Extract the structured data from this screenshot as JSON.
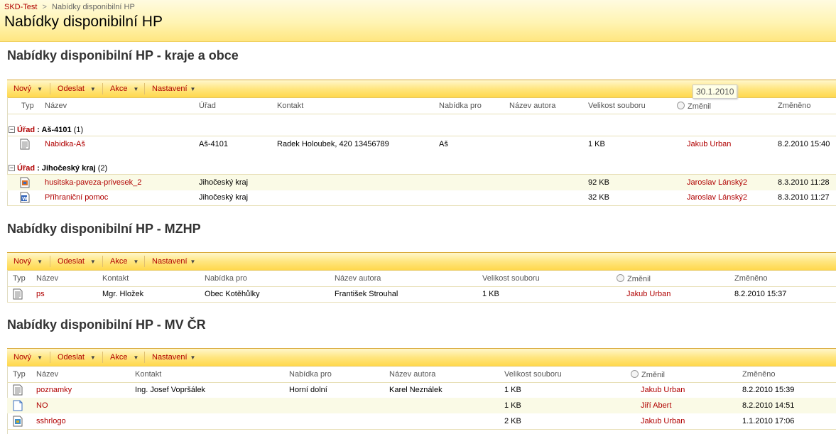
{
  "breadcrumb": {
    "site": "SKD-Test",
    "separator": ">",
    "current": "Nabídky disponibilní HP"
  },
  "page_title": "Nabídky disponibilní HP",
  "tooltip": "30.1.2010",
  "toolbar": {
    "new": "Nový",
    "send": "Odeslat",
    "actions": "Akce",
    "settings": "Nastavení"
  },
  "sections": [
    {
      "title": "Nabídky disponibilní HP - kraje a obce",
      "headers": [
        "Typ",
        "Název",
        "Úřad",
        "Kontakt",
        "Nabídka pro",
        "Název autora",
        "Velikost souboru",
        "Změnil",
        "Změněno"
      ],
      "groups": [
        {
          "label": "Úřad",
          "value": "Aš-4101",
          "count": "(1)",
          "rows": [
            {
              "icon": "text-document",
              "name": "Nabidka-Aš",
              "office": "Aš-4101",
              "contact": "Radek Holoubek, 420 13456789",
              "offer_for": "Aš",
              "author": "",
              "size": "1 KB",
              "changed_by": "Jakub Urban",
              "changed": "8.2.2010 15:40"
            }
          ]
        },
        {
          "label": "Úřad",
          "value": "Jihočeský kraj",
          "count": "(2)",
          "rows": [
            {
              "icon": "image-document",
              "name": "husitska-paveza-privesek_2",
              "office": "Jihočeský kraj",
              "contact": "",
              "offer_for": "",
              "author": "",
              "size": "92 KB",
              "changed_by": "Jaroslav Lánský2",
              "changed": "8.3.2010 11:28"
            },
            {
              "icon": "word-document",
              "name": "Příhraniční pomoc",
              "office": "Jihočeský kraj",
              "contact": "",
              "offer_for": "",
              "author": "",
              "size": "32 KB",
              "changed_by": "Jaroslav Lánský2",
              "changed": "8.3.2010 11:27"
            }
          ]
        }
      ]
    },
    {
      "title": "Nabídky disponibilní HP - MZHP",
      "headers": [
        "Typ",
        "Název",
        "Kontakt",
        "Nabídka pro",
        "Název autora",
        "Velikost souboru",
        "Změnil",
        "Změněno"
      ],
      "rows": [
        {
          "icon": "text-document",
          "name": "ps",
          "contact": "Mgr. Hložek",
          "offer_for": "Obec Kotěhůlky",
          "author": "František Strouhal",
          "size": "1 KB",
          "changed_by": "Jakub Urban",
          "changed": "8.2.2010 15:37"
        }
      ]
    },
    {
      "title": "Nabídky disponibilní HP - MV ČR",
      "headers": [
        "Typ",
        "Název",
        "Kontakt",
        "Nabídka pro",
        "Název autora",
        "Velikost souboru",
        "Změnil",
        "Změněno"
      ],
      "rows": [
        {
          "icon": "text-document",
          "name": "poznamky",
          "contact": "Ing. Josef Vopršálek",
          "offer_for": "Horní dolní",
          "author": "Karel Neználek",
          "size": "1 KB",
          "changed_by": "Jakub Urban",
          "changed": "8.2.2010 15:39"
        },
        {
          "icon": "blank-document",
          "name": "NO",
          "contact": "",
          "offer_for": "",
          "author": "",
          "size": "1 KB",
          "changed_by": "Jiří Abert",
          "changed": "8.2.2010 14:51"
        },
        {
          "icon": "image-document",
          "name": "sshrlogo",
          "contact": "",
          "offer_for": "",
          "author": "",
          "size": "2 KB",
          "changed_by": "Jakub Urban",
          "changed": "1.1.2010 17:06"
        }
      ]
    }
  ]
}
